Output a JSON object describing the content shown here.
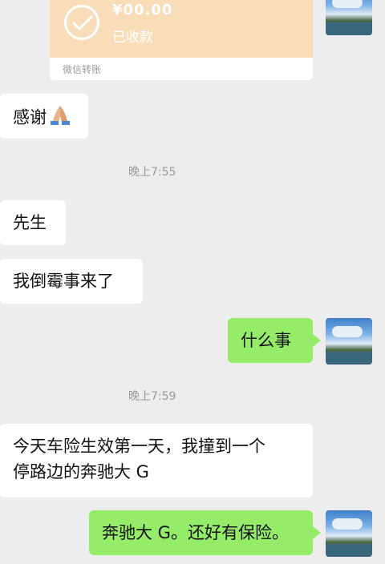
{
  "transfer": {
    "amount": "¥00.00",
    "status": "已收款",
    "footer": "微信转账"
  },
  "messages": [
    {
      "side": "left",
      "text": "感谢",
      "emoji": "praying-hands"
    },
    {
      "side": "left",
      "text": "先生"
    },
    {
      "side": "left",
      "text": "我倒霉事来了"
    },
    {
      "side": "right",
      "text": "什么事"
    },
    {
      "side": "left",
      "text": "今天车险生效第一天，我撞到一个",
      "text2": "停路边的奔驰大 G"
    },
    {
      "side": "right",
      "text": "奔驰大 G。还好有保险。"
    }
  ],
  "timestamps": [
    "晚上7:55",
    "晚上7:59"
  ],
  "colors": {
    "bubble_right": "#95ec69",
    "bubble_left": "#ffffff",
    "background": "#ededed",
    "transfer": "#f9dcb8"
  }
}
